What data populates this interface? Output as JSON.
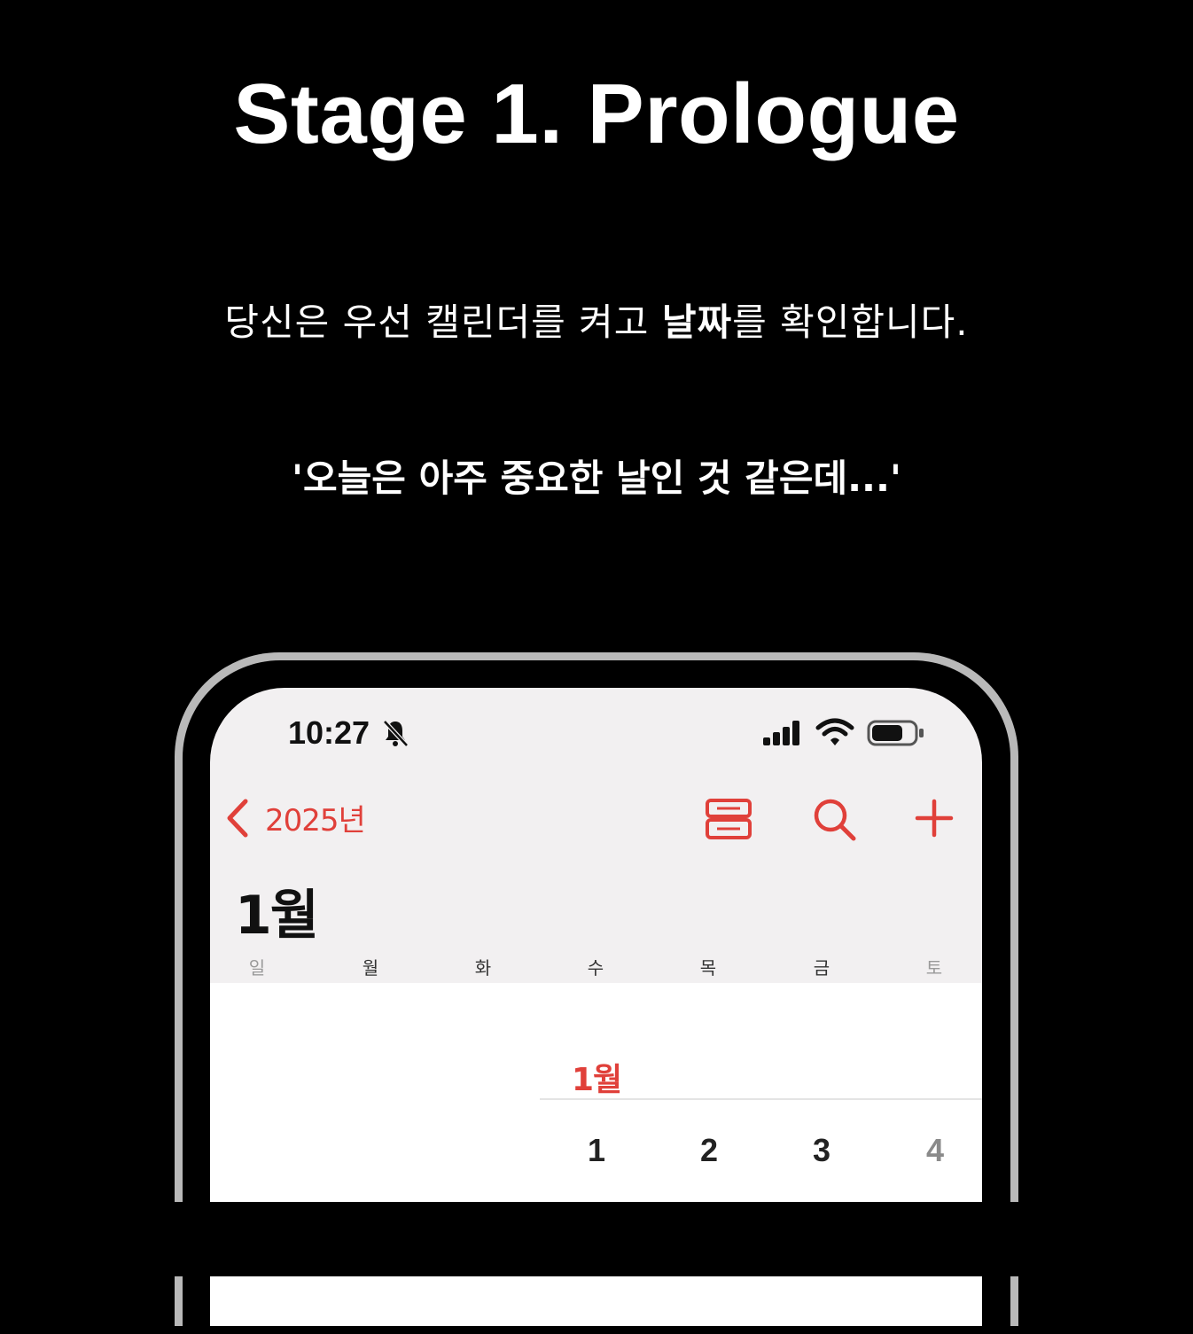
{
  "header": {
    "title": "Stage 1. Prologue",
    "line1_before": "당신은 우선 캘린더를 켜고 ",
    "line1_bold": "날짜",
    "line1_after": "를 확인합니다.",
    "line2": "'오늘은 아주 중요한 날인 것 같은데...'"
  },
  "phone": {
    "status": {
      "time": "10:27",
      "icons": [
        "bell-slash-icon",
        "signal-icon",
        "wifi-icon",
        "battery-icon"
      ]
    },
    "nav": {
      "back_label": "2025년",
      "icons": [
        "calendar-list-icon",
        "search-icon",
        "add-icon"
      ]
    },
    "month_title": "1월",
    "weekdays": [
      "일",
      "월",
      "화",
      "수",
      "목",
      "금",
      "토"
    ],
    "calendar": {
      "month_label": "1월",
      "first_week_days": [
        "1",
        "2",
        "3",
        "4"
      ]
    }
  },
  "colors": {
    "accent": "#e0403a",
    "background": "#000000",
    "screen": "#f2f0f1"
  }
}
